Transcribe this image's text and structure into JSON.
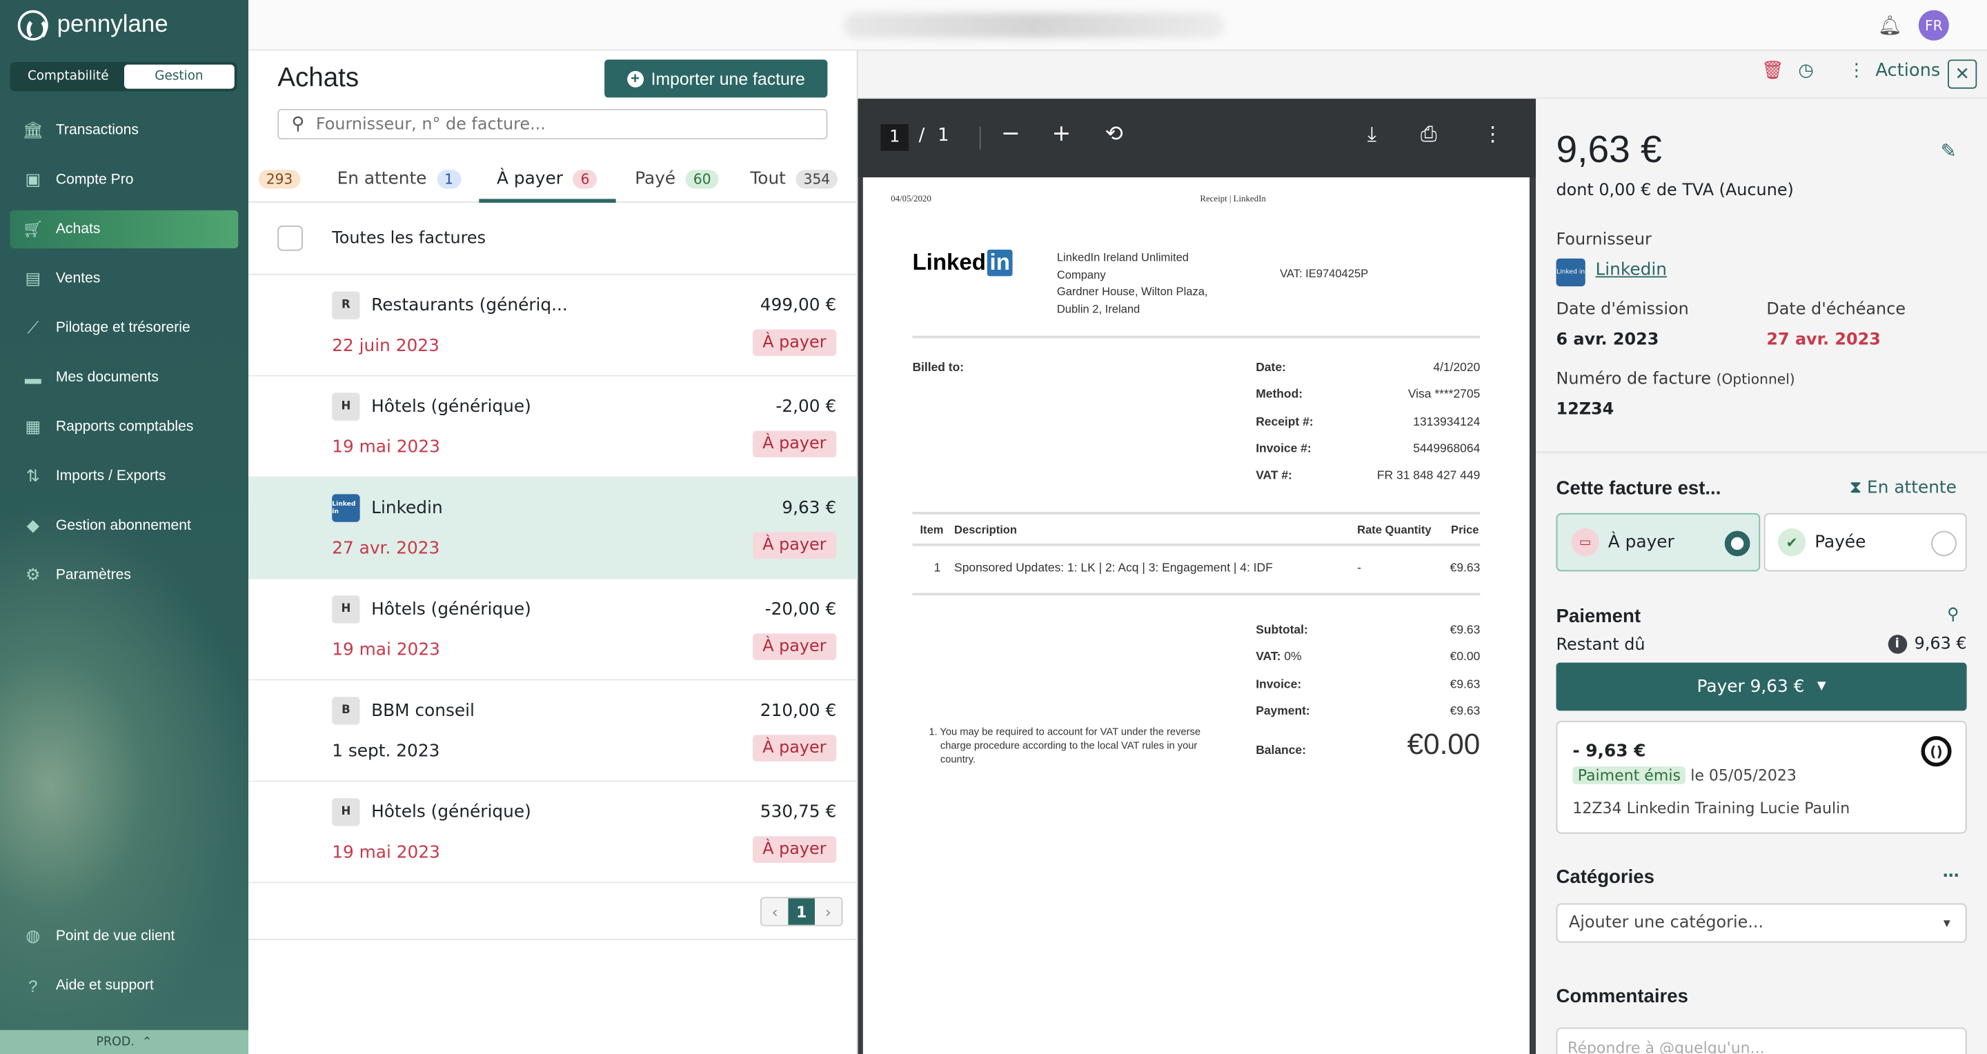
{
  "app": {
    "brand": "pennylane",
    "mode_toggle": [
      "Comptabilité",
      "Gestion"
    ],
    "active_mode": "Gestion",
    "user_initials": "FR",
    "env": "PROD."
  },
  "sidebar": {
    "items": [
      {
        "label": "Transactions",
        "icon": "bank-icon"
      },
      {
        "label": "Compte Pro",
        "icon": "wallet-icon"
      },
      {
        "label": "Achats",
        "icon": "cart-icon",
        "active": true
      },
      {
        "label": "Ventes",
        "icon": "store-icon"
      },
      {
        "label": "Pilotage et trésorerie",
        "icon": "chart-line-icon"
      },
      {
        "label": "Mes documents",
        "icon": "folder-icon"
      },
      {
        "label": "Rapports comptables",
        "icon": "report-icon"
      },
      {
        "label": "Imports / Exports",
        "icon": "import-export-icon"
      },
      {
        "label": "Gestion abonnement",
        "icon": "bag-icon"
      },
      {
        "label": "Paramètres",
        "icon": "gear-icon"
      }
    ],
    "bottom_items": [
      {
        "label": "Point de vue client",
        "icon": "globe-icon"
      },
      {
        "label": "Aide et support",
        "icon": "help-icon"
      }
    ]
  },
  "list": {
    "title": "Achats",
    "import_label": "Importer une facture",
    "search_placeholder": "Fournisseur, n° de facture...",
    "tabs": [
      {
        "label": "",
        "count": "293",
        "bg": "#fbe3cc"
      },
      {
        "label": "En attente",
        "count": "1",
        "bg": "#d8e6fb"
      },
      {
        "label": "À payer",
        "count": "6",
        "bg": "#f6d8dc",
        "active": true
      },
      {
        "label": "Payé",
        "count": "60",
        "bg": "#d6eedb"
      },
      {
        "label": "Tout",
        "count": "354",
        "bg": "#e4e4e4"
      }
    ],
    "select_all_label": "Toutes les factures",
    "rows": [
      {
        "initial": "R",
        "name": "Restaurants (génériq...",
        "amount": "499,00 €",
        "date": "22 juin 2023",
        "status": "À payer",
        "overdue": true
      },
      {
        "initial": "H",
        "name": "Hôtels (générique)",
        "amount": "-2,00 €",
        "date": "19 mai 2023",
        "status": "À payer",
        "overdue": true
      },
      {
        "initial": "Linkedin",
        "name": "Linkedin",
        "amount": "9,63 €",
        "date": "27 avr. 2023",
        "status": "À payer",
        "overdue": true,
        "selected": true
      },
      {
        "initial": "H",
        "name": "Hôtels (générique)",
        "amount": "-20,00 €",
        "date": "19 mai 2023",
        "status": "À payer",
        "overdue": true
      },
      {
        "initial": "B",
        "name": "BBM conseil",
        "amount": "210,00 €",
        "date": "1 sept. 2023",
        "status": "À payer",
        "overdue": false
      },
      {
        "initial": "H",
        "name": "Hôtels (générique)",
        "amount": "530,75 €",
        "date": "19 mai 2023",
        "status": "À payer",
        "overdue": true
      }
    ],
    "pagination": {
      "prev": "‹",
      "current": "1",
      "next": "›"
    }
  },
  "actions": {
    "actions_label": "Actions",
    "close": "✕"
  },
  "viewer": {
    "page_current": "1",
    "page_sep": "/",
    "page_total": "1"
  },
  "pdf": {
    "header_date": "04/05/2020",
    "header_title": "Receipt | LinkedIn",
    "logo_text": "Linked",
    "logo_in": "in",
    "company": [
      "LinkedIn Ireland Unlimited",
      "Company",
      "Gardner House, Wilton Plaza,",
      "Dublin 2, Ireland"
    ],
    "vat_company": "VAT: IE9740425P",
    "billed_to": "Billed to:",
    "meta": [
      {
        "k": "Date:",
        "v": "4/1/2020"
      },
      {
        "k": "Method:",
        "v": "Visa ****2705"
      },
      {
        "k": "Receipt #:",
        "v": "1313934124"
      },
      {
        "k": "Invoice #:",
        "v": "5449968064"
      },
      {
        "k": "VAT #:",
        "v": "FR 31 848 427 449"
      }
    ],
    "table_head": {
      "item": "Item",
      "desc": "Description",
      "rate": "Rate Quantity",
      "price": "Price"
    },
    "line": {
      "item": "1",
      "desc": "Sponsored Updates: 1: LK | 2: Acq | 3: Engagement | 4: IDF",
      "rate": "-",
      "price": "€9.63"
    },
    "totals": [
      {
        "k": "Subtotal:",
        "v": "€9.63"
      },
      {
        "k": "VAT:",
        "k2": " 0%",
        "v": "€0.00"
      },
      {
        "k": "Invoice:",
        "v": "€9.63"
      },
      {
        "k": "Payment:",
        "v": "€9.63"
      }
    ],
    "balance_label": "Balance:",
    "balance": "€0.00",
    "note": "1. You may be required to account for VAT under the reverse charge procedure according to the local VAT rules in your country."
  },
  "detail": {
    "amount": "9,63 €",
    "vat_line": "dont 0,00 € de TVA (Aucune)",
    "supplier_label": "Fournisseur",
    "supplier": "Linkedin",
    "issue_label": "Date d'émission",
    "issue": "6 avr. 2023",
    "due_label": "Date d'échéance",
    "due": "27 avr. 2023",
    "invoice_no_label": "Numéro de facture",
    "invoice_no_opt": "(Optionnel)",
    "invoice_no": "12Z34",
    "status_heading": "Cette facture est...",
    "status_tag": "En attente",
    "opt_topay": "À payer",
    "opt_paid": "Payée",
    "payment_heading": "Paiement",
    "remaining_label": "Restant dû",
    "remaining": "9,63 €",
    "pay_button": "Payer 9,63 €",
    "payment": {
      "amount": "- 9,63 €",
      "badge": "Paiment émis",
      "date": "le 05/05/2023",
      "ref": "12Z34 Linkedin Training Lucie Paulin"
    },
    "categories_heading": "Catégories",
    "categories_placeholder": "Ajouter une catégorie...",
    "comments_heading": "Commentaires",
    "comment_placeholder": "Répondre à @quelqu'un..."
  },
  "colors": {
    "primary": "#2b6664",
    "danger": "#c73a4a",
    "sidebar": "#2b5957",
    "selected_row": "#deeee9"
  }
}
